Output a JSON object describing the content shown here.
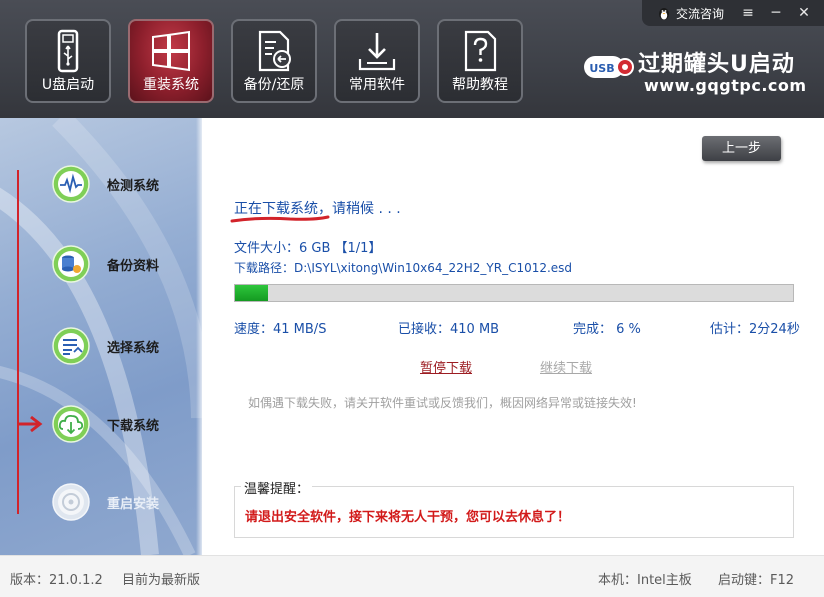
{
  "window": {
    "consult_label": "交流咨询",
    "menu_glyph": "≡",
    "minimize_glyph": "─",
    "close_glyph": "✕"
  },
  "nav": [
    {
      "label": "U盘启动",
      "icon": "usb-drive-icon",
      "active": false
    },
    {
      "label": "重装系统",
      "icon": "windows-logo-icon",
      "active": true
    },
    {
      "label": "备份/还原",
      "icon": "backup-restore-icon",
      "active": false
    },
    {
      "label": "常用软件",
      "icon": "software-download-icon",
      "active": false
    },
    {
      "label": "帮助教程",
      "icon": "help-document-icon",
      "active": false
    }
  ],
  "brand": {
    "badge": "USB",
    "name": "过期罐头U启动",
    "url": "www.gqgtpc.com"
  },
  "steps": [
    {
      "label": "检测系统",
      "icon": "monitor-pulse-icon",
      "state": "done"
    },
    {
      "label": "备份资料",
      "icon": "database-gear-icon",
      "state": "done"
    },
    {
      "label": "选择系统",
      "icon": "list-select-icon",
      "state": "done"
    },
    {
      "label": "下载系统",
      "icon": "cloud-download-icon",
      "state": "current"
    },
    {
      "label": "重启安装",
      "icon": "disc-install-icon",
      "state": "pending"
    }
  ],
  "main": {
    "prev_button": "上一步",
    "status": "正在下载系统，请稍候 . . .",
    "file_size": "文件大小：6 GB 【1/1】",
    "download_path": "下载路径：D:\\ISYL\\xitong\\Win10x64_22H2_YR_C1012.esd",
    "progress_percent": 6,
    "speed": "速度：41 MB/S",
    "received": "已接收：410 MB",
    "completed": "完成： 6 %",
    "estimate": "估计：2分24秒",
    "pause_link": "暂停下载",
    "resume_link": "继续下载",
    "hint": "如偶遇下载失败，请关开软件重试或反馈我们，概因网络异常或链接失效!",
    "tips_title": "温馨提醒：",
    "tips_message": "请退出安全软件，接下来将无人干预，您可以去休息了！"
  },
  "footer": {
    "version": "版本：21.0.1.2",
    "latest": "目前为最新版",
    "board": "本机：Intel主板",
    "hotkey": "启动键：F12"
  },
  "colors": {
    "active_nav": "#8d1f2c",
    "status_text": "#1a4fa8",
    "progress_fill": "#1fb12e",
    "warning_text": "#d21a1a",
    "step_line": "#d2232a"
  }
}
